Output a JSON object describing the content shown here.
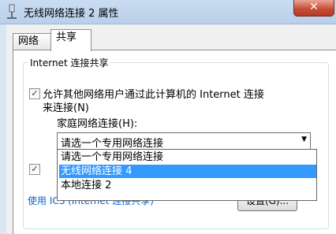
{
  "window": {
    "title": "无线网络连接 2 属性",
    "close_glyph": "✕",
    "title_icon": "network-adapter-icon"
  },
  "tabs": [
    {
      "label": "网络"
    },
    {
      "label": "共享"
    }
  ],
  "group": {
    "legend": "Internet 连接共享",
    "allow_checkbox": {
      "checked": true,
      "line1": "允许其他网络用户通过此计算机的 Internet 连接",
      "line2": "来连接(N)"
    },
    "home_label": "家庭网络连接(H):",
    "combo": {
      "value": "请选一个专用网络连接",
      "arrow": "▼"
    },
    "dropdown_options": [
      {
        "label": "请选一个专用网络连接",
        "selected": false
      },
      {
        "label": "无线网络连接 4",
        "selected": true
      },
      {
        "label": "本地连接 2",
        "selected": false
      }
    ],
    "second_checkbox": {
      "checked": true
    },
    "ics_link": "使用 ICS (Internet 连接共享)",
    "settings_button": "设置(G)..."
  },
  "colors": {
    "selection": "#3399ff",
    "link": "#0066cc",
    "close": "#c8503a"
  }
}
